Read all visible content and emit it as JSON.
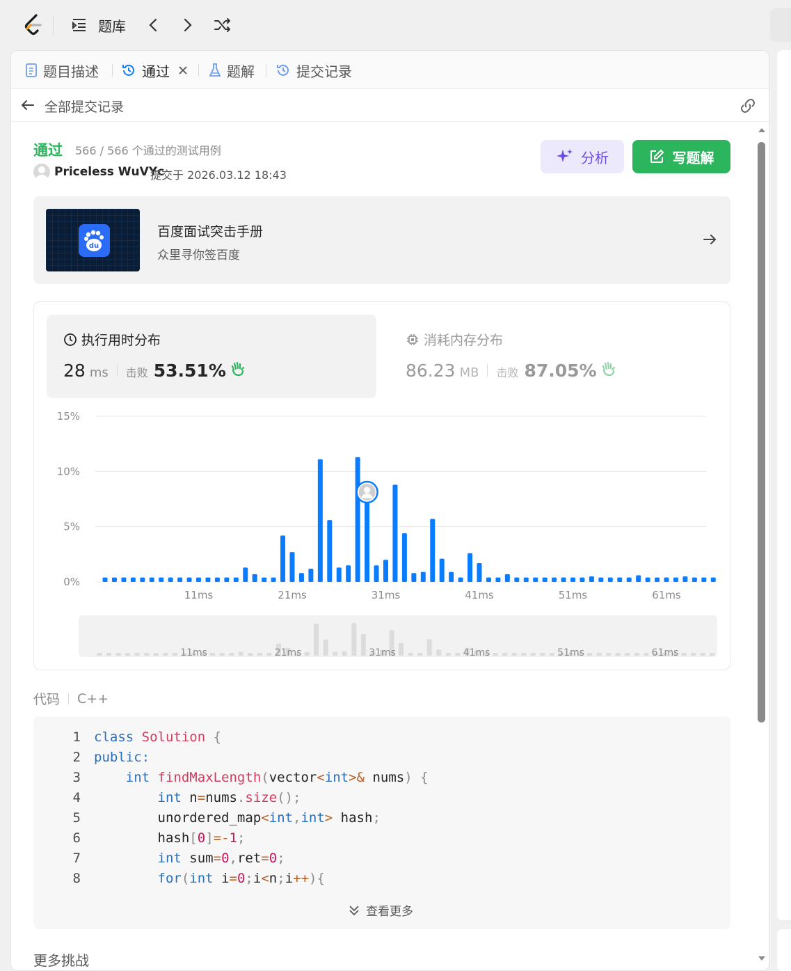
{
  "topbar": {
    "title": "题库"
  },
  "tabs": [
    {
      "label": "题目描述"
    },
    {
      "label": "通过"
    },
    {
      "label": "题解"
    },
    {
      "label": "提交记录"
    }
  ],
  "subnav": {
    "title": "全部提交记录"
  },
  "submission": {
    "status": "通过",
    "testcases": "566 / 566 个通过的测试用例",
    "user": "Priceless WuVYc",
    "submitted": "提交于 2026.03.12 18:43",
    "analyze_label": "分析",
    "solution_label": "写题解"
  },
  "promo": {
    "title": "百度面试突击手册",
    "subtitle": "众里寻你签百度",
    "logo_text": "du"
  },
  "runtime": {
    "heading": "执行用时分布",
    "value": "28",
    "unit": "ms",
    "beat_label": "击败",
    "beat_value": "53.51%"
  },
  "memory": {
    "heading": "消耗内存分布",
    "value": "86.23",
    "unit": "MB",
    "beat_label": "击败",
    "beat_value": "87.05%"
  },
  "chart_data": {
    "type": "bar",
    "title": "",
    "xlabel": "",
    "ylabel": "",
    "ylim": [
      0,
      15
    ],
    "yticks": [
      "0%",
      "5%",
      "10%",
      "15%"
    ],
    "x_start_ms": 0,
    "x_step_ms": 1,
    "xtick_labels": [
      "11ms",
      "21ms",
      "31ms",
      "41ms",
      "51ms",
      "61ms"
    ],
    "values": [
      0.4,
      0.4,
      0.4,
      0.4,
      0.4,
      0.4,
      0.4,
      0.4,
      0.4,
      0.4,
      0.4,
      0.4,
      0.4,
      0.4,
      0.4,
      1.3,
      0.7,
      0.4,
      0.4,
      4.2,
      2.7,
      0.8,
      1.2,
      11.1,
      5.6,
      1.3,
      1.5,
      11.3,
      7.5,
      1.5,
      2.0,
      8.8,
      4.4,
      0.8,
      0.9,
      5.7,
      2.1,
      0.9,
      0.4,
      2.6,
      1.7,
      0.4,
      0.4,
      0.7,
      0.4,
      0.4,
      0.4,
      0.4,
      0.4,
      0.4,
      0.4,
      0.4,
      0.5,
      0.4,
      0.4,
      0.4,
      0.4,
      0.6,
      0.4,
      0.4,
      0.4,
      0.4,
      0.5,
      0.4,
      0.4,
      0.4,
      0.4,
      0.4,
      0.4
    ],
    "highlight_index": 28,
    "color": "#0a7cff"
  },
  "code": {
    "label": "代码",
    "language": "C++",
    "more_label": "查看更多",
    "line_numbers": [
      "1",
      "2",
      "3",
      "4",
      "5",
      "6",
      "7",
      "8"
    ]
  },
  "more_challenges": "更多挑战"
}
